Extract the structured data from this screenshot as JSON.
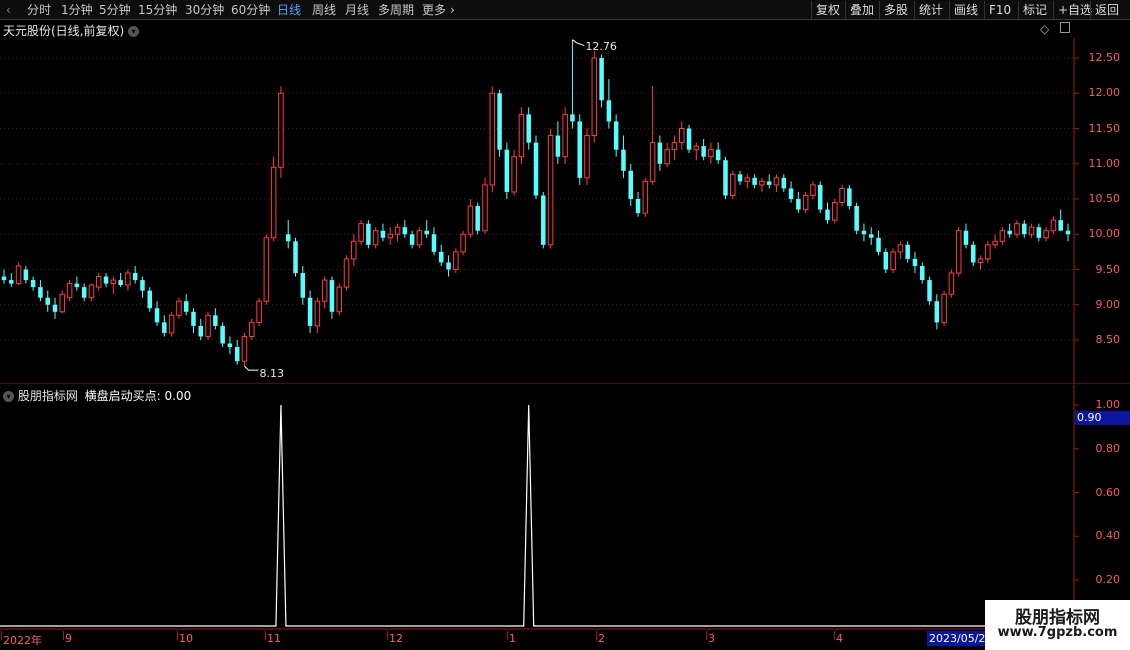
{
  "toolbar": {
    "periods": [
      "分时",
      "1分钟",
      "5分钟",
      "15分钟",
      "30分钟",
      "60分钟",
      "日线",
      "周线",
      "月线",
      "多周期",
      "更多"
    ],
    "active_period": "日线",
    "right_buttons": [
      "复权",
      "叠加",
      "多股",
      "统计",
      "画线",
      "F10",
      "标记",
      "+自选",
      "返回"
    ]
  },
  "stock": {
    "title": "天元股份(日线,前复权)"
  },
  "main_chart": {
    "high_label": "12.76",
    "low_label": "8.13",
    "y_ticks": [
      "12.50",
      "12.00",
      "11.50",
      "11.00",
      "10.50",
      "10.00",
      "9.50",
      "9.00",
      "8.50"
    ]
  },
  "indicator": {
    "title": "股朋指标网",
    "name_value": "横盘启动买点: 0.00",
    "current_value": "0.90",
    "y_ticks": [
      "1.00",
      "0.80",
      "0.60",
      "0.40",
      "0.20"
    ]
  },
  "x_axis": {
    "labels": [
      "2022年",
      "9",
      "10",
      "11",
      "12",
      "1",
      "2",
      "3",
      "4"
    ],
    "current_date": "2023/05/22"
  },
  "watermark": {
    "line1": "股朋指标网",
    "line2": "www.7gpzb.com"
  },
  "chart_data": {
    "type": "candlestick",
    "up_color": "#ff3b3b",
    "down_color": "#54ffff",
    "ylim": [
      8.0,
      12.9
    ],
    "candles_ohlc": [
      [
        9.4,
        9.5,
        9.3,
        9.35
      ],
      [
        9.35,
        9.45,
        9.25,
        9.3
      ],
      [
        9.3,
        9.6,
        9.28,
        9.55
      ],
      [
        9.5,
        9.55,
        9.3,
        9.35
      ],
      [
        9.35,
        9.4,
        9.2,
        9.25
      ],
      [
        9.25,
        9.35,
        9.05,
        9.1
      ],
      [
        9.1,
        9.2,
        8.9,
        9.0
      ],
      [
        9.0,
        9.1,
        8.8,
        8.9
      ],
      [
        8.9,
        9.2,
        8.88,
        9.15
      ],
      [
        9.1,
        9.35,
        9.05,
        9.3
      ],
      [
        9.3,
        9.4,
        9.2,
        9.25
      ],
      [
        9.25,
        9.3,
        9.05,
        9.1
      ],
      [
        9.1,
        9.3,
        9.05,
        9.28
      ],
      [
        9.25,
        9.45,
        9.2,
        9.4
      ],
      [
        9.4,
        9.45,
        9.25,
        9.3
      ],
      [
        9.3,
        9.4,
        9.15,
        9.35
      ],
      [
        9.35,
        9.45,
        9.25,
        9.28
      ],
      [
        9.28,
        9.5,
        9.2,
        9.45
      ],
      [
        9.45,
        9.55,
        9.3,
        9.35
      ],
      [
        9.35,
        9.4,
        9.1,
        9.2
      ],
      [
        9.2,
        9.25,
        8.9,
        8.95
      ],
      [
        8.95,
        9.05,
        8.7,
        8.75
      ],
      [
        8.75,
        8.85,
        8.55,
        8.6
      ],
      [
        8.6,
        8.9,
        8.55,
        8.85
      ],
      [
        8.85,
        9.1,
        8.8,
        9.05
      ],
      [
        9.05,
        9.15,
        8.85,
        8.9
      ],
      [
        8.9,
        8.95,
        8.6,
        8.7
      ],
      [
        8.7,
        8.8,
        8.5,
        8.55
      ],
      [
        8.55,
        8.9,
        8.5,
        8.85
      ],
      [
        8.85,
        8.95,
        8.65,
        8.7
      ],
      [
        8.7,
        8.75,
        8.4,
        8.45
      ],
      [
        8.45,
        8.55,
        8.3,
        8.4
      ],
      [
        8.4,
        8.5,
        8.15,
        8.2
      ],
      [
        8.2,
        8.6,
        8.13,
        8.55
      ],
      [
        8.55,
        8.8,
        8.5,
        8.75
      ],
      [
        8.75,
        9.1,
        8.7,
        9.05
      ],
      [
        9.05,
        10.0,
        9.0,
        9.95
      ],
      [
        9.95,
        11.1,
        9.9,
        10.95
      ],
      [
        10.95,
        12.1,
        10.8,
        12.0
      ],
      [
        10.0,
        10.2,
        9.8,
        9.9
      ],
      [
        9.9,
        9.95,
        9.4,
        9.45
      ],
      [
        9.45,
        9.55,
        9.0,
        9.1
      ],
      [
        9.1,
        9.2,
        8.6,
        8.7
      ],
      [
        8.7,
        9.1,
        8.6,
        9.05
      ],
      [
        9.05,
        9.4,
        8.95,
        9.35
      ],
      [
        9.35,
        9.4,
        8.8,
        8.9
      ],
      [
        8.9,
        9.3,
        8.85,
        9.25
      ],
      [
        9.25,
        9.7,
        9.2,
        9.65
      ],
      [
        9.65,
        10.0,
        9.55,
        9.9
      ],
      [
        9.9,
        10.2,
        9.85,
        10.15
      ],
      [
        10.15,
        10.2,
        9.8,
        9.85
      ],
      [
        9.85,
        10.1,
        9.8,
        10.05
      ],
      [
        10.05,
        10.15,
        9.9,
        9.95
      ],
      [
        9.95,
        10.1,
        9.85,
        10.0
      ],
      [
        10.0,
        10.15,
        9.9,
        10.1
      ],
      [
        10.1,
        10.2,
        9.95,
        10.0
      ],
      [
        10.0,
        10.05,
        9.8,
        9.85
      ],
      [
        9.85,
        10.1,
        9.8,
        10.05
      ],
      [
        10.05,
        10.2,
        9.95,
        10.0
      ],
      [
        10.0,
        10.1,
        9.7,
        9.75
      ],
      [
        9.75,
        9.85,
        9.55,
        9.6
      ],
      [
        9.6,
        9.7,
        9.4,
        9.5
      ],
      [
        9.5,
        9.8,
        9.45,
        9.75
      ],
      [
        9.75,
        10.05,
        9.7,
        10.0
      ],
      [
        10.0,
        10.5,
        9.95,
        10.4
      ],
      [
        10.4,
        10.45,
        10.0,
        10.05
      ],
      [
        10.05,
        10.8,
        10.0,
        10.7
      ],
      [
        10.7,
        12.1,
        10.6,
        12.0
      ],
      [
        12.0,
        12.05,
        11.1,
        11.2
      ],
      [
        11.2,
        11.3,
        10.5,
        10.6
      ],
      [
        10.6,
        11.2,
        10.55,
        11.1
      ],
      [
        11.1,
        11.8,
        11.0,
        11.7
      ],
      [
        11.7,
        11.8,
        11.2,
        11.3
      ],
      [
        11.3,
        11.4,
        10.5,
        10.55
      ],
      [
        10.55,
        10.6,
        9.8,
        9.85
      ],
      [
        9.85,
        11.5,
        9.8,
        11.4
      ],
      [
        11.4,
        11.6,
        11.0,
        11.1
      ],
      [
        11.1,
        11.8,
        11.0,
        11.7
      ],
      [
        11.7,
        12.76,
        11.5,
        11.6
      ],
      [
        11.6,
        11.7,
        10.7,
        10.8
      ],
      [
        10.8,
        11.5,
        10.7,
        11.4
      ],
      [
        11.4,
        12.6,
        11.3,
        12.5
      ],
      [
        12.5,
        12.55,
        11.8,
        11.9
      ],
      [
        11.9,
        12.2,
        11.5,
        11.6
      ],
      [
        11.6,
        11.7,
        11.1,
        11.2
      ],
      [
        11.2,
        11.4,
        10.8,
        10.9
      ],
      [
        10.9,
        11.0,
        10.4,
        10.5
      ],
      [
        10.5,
        10.6,
        10.25,
        10.3
      ],
      [
        10.3,
        10.8,
        10.25,
        10.75
      ],
      [
        10.75,
        12.1,
        10.7,
        11.3
      ],
      [
        11.3,
        11.4,
        10.9,
        11.0
      ],
      [
        11.0,
        11.3,
        10.95,
        11.2
      ],
      [
        11.2,
        11.4,
        11.05,
        11.3
      ],
      [
        11.3,
        11.6,
        11.2,
        11.5
      ],
      [
        11.5,
        11.55,
        11.15,
        11.2
      ],
      [
        11.2,
        11.3,
        11.05,
        11.25
      ],
      [
        11.25,
        11.35,
        11.05,
        11.1
      ],
      [
        11.1,
        11.3,
        11.0,
        11.2
      ],
      [
        11.2,
        11.3,
        11.0,
        11.05
      ],
      [
        11.05,
        11.1,
        10.5,
        10.55
      ],
      [
        10.55,
        10.9,
        10.5,
        10.85
      ],
      [
        10.85,
        10.9,
        10.7,
        10.75
      ],
      [
        10.75,
        10.85,
        10.65,
        10.8
      ],
      [
        10.8,
        10.85,
        10.65,
        10.7
      ],
      [
        10.7,
        10.8,
        10.6,
        10.75
      ],
      [
        10.75,
        10.85,
        10.65,
        10.7
      ],
      [
        10.7,
        10.85,
        10.6,
        10.8
      ],
      [
        10.8,
        10.85,
        10.6,
        10.65
      ],
      [
        10.65,
        10.75,
        10.45,
        10.5
      ],
      [
        10.5,
        10.6,
        10.3,
        10.35
      ],
      [
        10.35,
        10.6,
        10.3,
        10.55
      ],
      [
        10.55,
        10.75,
        10.5,
        10.7
      ],
      [
        10.7,
        10.75,
        10.3,
        10.35
      ],
      [
        10.35,
        10.45,
        10.15,
        10.2
      ],
      [
        10.2,
        10.5,
        10.15,
        10.45
      ],
      [
        10.45,
        10.7,
        10.4,
        10.65
      ],
      [
        10.65,
        10.7,
        10.35,
        10.4
      ],
      [
        10.4,
        10.45,
        10.0,
        10.05
      ],
      [
        10.05,
        10.15,
        9.9,
        10.0
      ],
      [
        10.0,
        10.1,
        9.85,
        9.95
      ],
      [
        9.95,
        10.05,
        9.7,
        9.75
      ],
      [
        9.75,
        9.8,
        9.45,
        9.5
      ],
      [
        9.5,
        9.8,
        9.45,
        9.75
      ],
      [
        9.75,
        9.9,
        9.65,
        9.85
      ],
      [
        9.85,
        9.9,
        9.6,
        9.65
      ],
      [
        9.65,
        9.75,
        9.45,
        9.55
      ],
      [
        9.55,
        9.6,
        9.3,
        9.35
      ],
      [
        9.35,
        9.4,
        9.0,
        9.05
      ],
      [
        9.05,
        9.15,
        8.65,
        8.75
      ],
      [
        8.75,
        9.2,
        8.7,
        9.15
      ],
      [
        9.15,
        9.5,
        9.1,
        9.45
      ],
      [
        9.45,
        10.1,
        9.4,
        10.05
      ],
      [
        10.05,
        10.15,
        9.8,
        9.85
      ],
      [
        9.85,
        9.9,
        9.55,
        9.6
      ],
      [
        9.6,
        9.7,
        9.5,
        9.65
      ],
      [
        9.65,
        9.9,
        9.6,
        9.85
      ],
      [
        9.85,
        10.0,
        9.8,
        9.9
      ],
      [
        9.9,
        10.1,
        9.85,
        10.05
      ],
      [
        10.05,
        10.15,
        9.95,
        10.0
      ],
      [
        10.0,
        10.2,
        9.95,
        10.15
      ],
      [
        10.15,
        10.2,
        9.95,
        10.0
      ],
      [
        10.0,
        10.15,
        9.95,
        10.1
      ],
      [
        10.1,
        10.15,
        9.9,
        9.95
      ],
      [
        9.95,
        10.1,
        9.9,
        10.05
      ],
      [
        10.05,
        10.25,
        10.0,
        10.2
      ],
      [
        10.2,
        10.35,
        10.15,
        10.05
      ],
      [
        10.05,
        10.15,
        9.9,
        10.0
      ]
    ],
    "indicator_spikes": [
      38,
      72
    ],
    "indicator_ylim": [
      0,
      1.0
    ]
  }
}
